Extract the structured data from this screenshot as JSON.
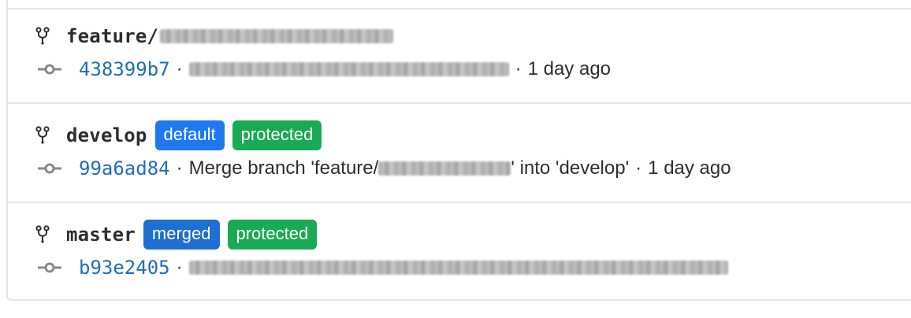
{
  "branches": [
    {
      "name": "feature/",
      "badges": [],
      "commit": {
        "sha": "438399b7",
        "message_prefix": "",
        "message_suffix": "",
        "time": "1 day ago"
      }
    },
    {
      "name": "develop",
      "badges": [
        {
          "label": "default",
          "kind": "default"
        },
        {
          "label": "protected",
          "kind": "protected"
        }
      ],
      "commit": {
        "sha": "99a6ad84",
        "message_prefix": "Merge branch 'feature/",
        "message_suffix": "' into 'develop'",
        "time": "1 day ago"
      }
    },
    {
      "name": "master",
      "badges": [
        {
          "label": "merged",
          "kind": "merged"
        },
        {
          "label": "protected",
          "kind": "protected"
        }
      ],
      "commit": {
        "sha": "b93e2405",
        "message_prefix": "",
        "message_suffix": "",
        "time": ""
      }
    }
  ],
  "separator": "·",
  "colors": {
    "sha": "#1f6fb8",
    "badge_default": "#1f78f0",
    "badge_merged": "#1f6fd1",
    "badge_protected": "#1aaa55",
    "border": "#e5e5e5"
  },
  "icons": {
    "branch": "git-branch-icon",
    "commit": "git-commit-icon"
  }
}
